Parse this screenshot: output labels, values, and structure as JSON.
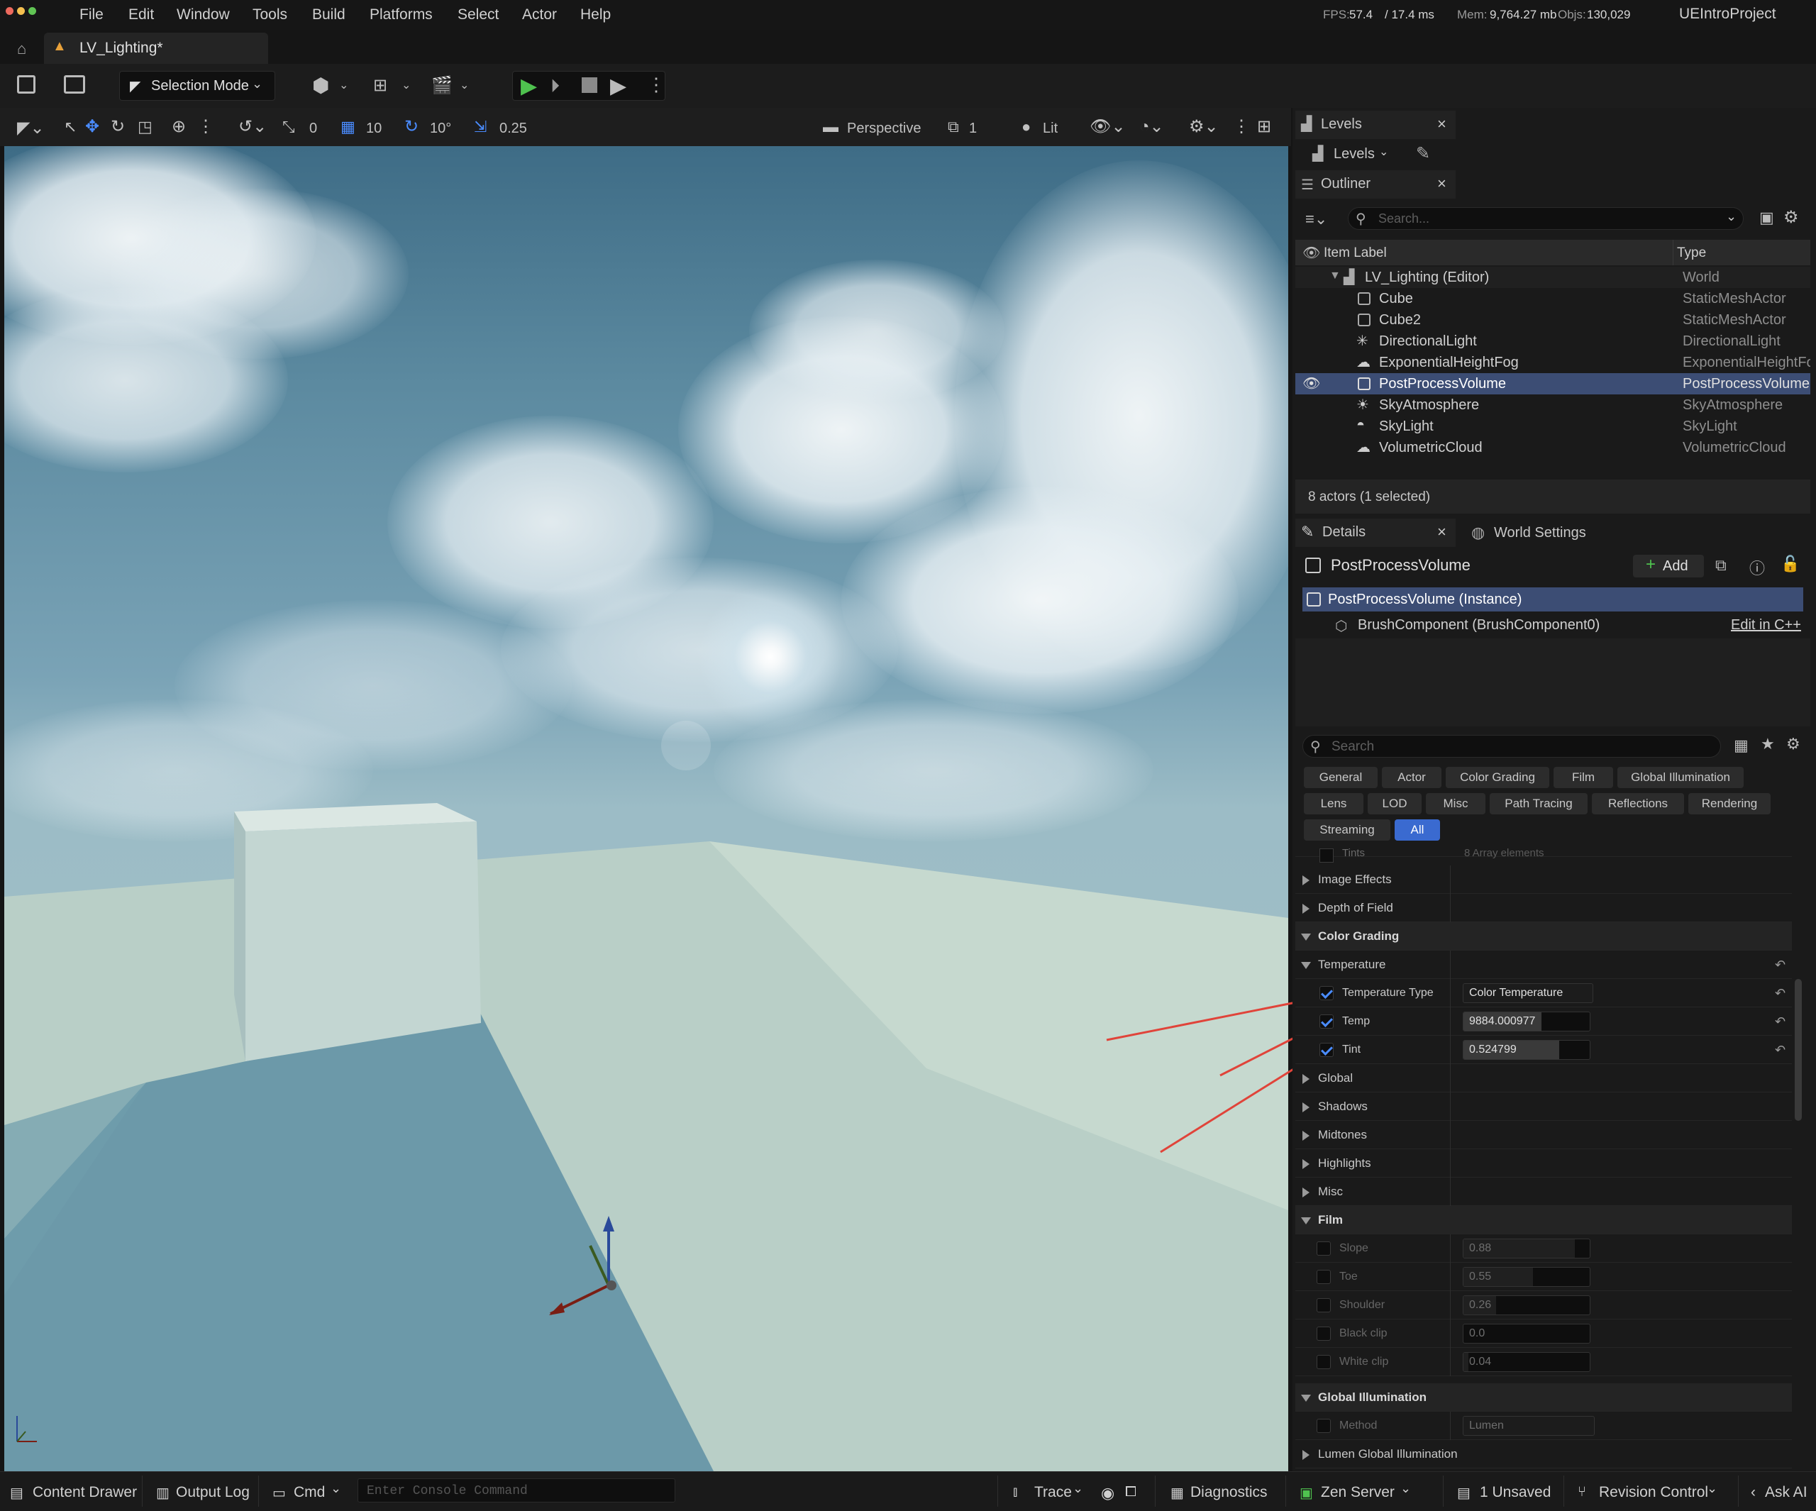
{
  "menubar": {
    "items": [
      "File",
      "Edit",
      "Window",
      "Tools",
      "Build",
      "Platforms",
      "Select",
      "Actor",
      "Help"
    ],
    "fps_label": "FPS:",
    "fps": "57.4",
    "frame_time": "/ 17.4 ms",
    "mem_label": "Mem:",
    "mem": "9,764.27 mb",
    "objs_label": "Objs:",
    "objs": "130,029",
    "project": "UEIntroProject"
  },
  "tab": {
    "title": "LV_Lighting*"
  },
  "toolbar": {
    "mode": "Selection Mode"
  },
  "viewport_toolbar": {
    "rotate_snap": "0",
    "grid_snap": "10",
    "angle_snap": "10°",
    "scale_snap": "0.25",
    "perspective": "Perspective",
    "camera_speed": "1",
    "view_mode": "Lit"
  },
  "levels": {
    "panel_title": "Levels",
    "dropdown": "Levels"
  },
  "outliner": {
    "panel_title": "Outliner",
    "search_placeholder": "Search...",
    "col_label": "Item Label",
    "col_type": "Type",
    "items": [
      {
        "label": "LV_Lighting (Editor)",
        "type": "World"
      },
      {
        "label": "Cube",
        "type": "StaticMeshActor"
      },
      {
        "label": "Cube2",
        "type": "StaticMeshActor"
      },
      {
        "label": "DirectionalLight",
        "type": "DirectionalLight"
      },
      {
        "label": "ExponentialHeightFog",
        "type": "ExponentialHeightFog"
      },
      {
        "label": "PostProcessVolume",
        "type": "PostProcessVolume"
      },
      {
        "label": "SkyAtmosphere",
        "type": "SkyAtmosphere"
      },
      {
        "label": "SkyLight",
        "type": "SkyLight"
      },
      {
        "label": "VolumetricCloud",
        "type": "VolumetricCloud"
      }
    ],
    "summary": "8 actors (1 selected)"
  },
  "details": {
    "tab_title": "Details",
    "world_settings": "World Settings",
    "actor_name": "PostProcessVolume",
    "add_label": "Add",
    "instance": "PostProcessVolume (Instance)",
    "component": "BrushComponent (BrushComponent0)",
    "edit_cpp": "Edit in C++",
    "search_placeholder": "Search",
    "filters": [
      "General",
      "Actor",
      "Color Grading",
      "Film",
      "Global Illumination",
      "Lens",
      "LOD",
      "Misc",
      "Path Tracing",
      "Reflections",
      "Rendering",
      "Streaming",
      "All"
    ],
    "partial_row": {
      "name": "Tints",
      "value": "8 Array elements"
    },
    "rows": {
      "image_effects": "Image Effects",
      "depth_of_field": "Depth of Field",
      "color_grading": "Color Grading",
      "temperature": "Temperature",
      "temperature_type": "Temperature Type",
      "temperature_type_value": "Color Temperature",
      "temp": "Temp",
      "temp_value": "9884.000977",
      "tint": "Tint",
      "tint_value": "0.524799",
      "global": "Global",
      "shadows": "Shadows",
      "midtones": "Midtones",
      "highlights": "Highlights",
      "misc": "Misc",
      "film": "Film",
      "slope": "Slope",
      "slope_value": "0.88",
      "toe": "Toe",
      "toe_value": "0.55",
      "shoulder": "Shoulder",
      "shoulder_value": "0.26",
      "black_clip": "Black clip",
      "black_clip_value": "0.0",
      "white_clip": "White clip",
      "white_clip_value": "0.04",
      "global_illumination": "Global Illumination",
      "method": "Method",
      "method_value": "Lumen",
      "lumen_gi": "Lumen Global Illumination"
    }
  },
  "statusbar": {
    "content_drawer": "Content Drawer",
    "output_log": "Output Log",
    "cmd": "Cmd",
    "console_placeholder": "Enter Console Command",
    "trace": "Trace",
    "diagnostics": "Diagnostics",
    "zen_server": "Zen Server",
    "unsaved": "1 Unsaved",
    "revision_control": "Revision Control",
    "ask_ai": "Ask AI"
  },
  "colors": {
    "accent": "#3a6ad0",
    "selected_row": "#3c4d74",
    "play_green": "#4fc24f",
    "annotation_arrow": "#e0443a"
  }
}
